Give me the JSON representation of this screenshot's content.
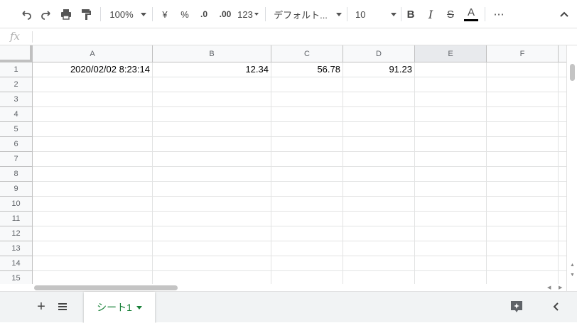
{
  "toolbar": {
    "zoom": "100%",
    "currency": "¥",
    "percent": "%",
    "decrease_decimal": ".0",
    "increase_decimal": ".00",
    "number_format": "123",
    "font": "デフォルト...",
    "font_size": "10",
    "bold": "B",
    "italic": "I",
    "strikethrough": "S",
    "text_color_label": "A",
    "more": "⋯",
    "text_color": "#000000"
  },
  "formula_bar": {
    "fx_label": "fx",
    "value": ""
  },
  "columns": [
    "A",
    "B",
    "C",
    "D",
    "E",
    "F"
  ],
  "rows": [
    "1",
    "2",
    "3",
    "4",
    "5",
    "6",
    "7",
    "8",
    "9",
    "10",
    "11",
    "12",
    "13",
    "14",
    "15"
  ],
  "cells": {
    "A1": "2020/02/02 8:23:14",
    "B1": "12.34",
    "C1": "56.78",
    "D1": "91.23"
  },
  "sheet_tab": {
    "name": "シート1"
  },
  "colors": {
    "accent": "#188038",
    "header_bg": "#f8f9fa"
  }
}
